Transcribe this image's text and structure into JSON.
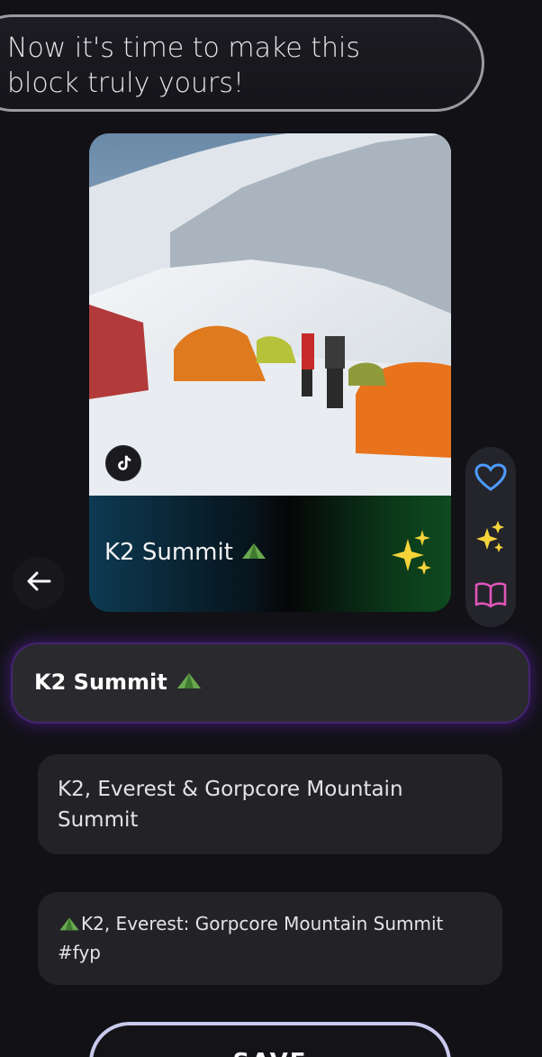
{
  "prompt": {
    "text": "Now it's time to make this block truly yours!"
  },
  "card": {
    "image_alt": "climbers and orange tents at a snowy mountain camp",
    "source_icon": "tiktok-icon",
    "title": "K2 Summit",
    "title_emoji": "tent-icon",
    "sparkle_icon": "sparkles-icon"
  },
  "rail": {
    "items": [
      {
        "icon": "heart-icon",
        "color": "#4d9bff"
      },
      {
        "icon": "sparkles-icon",
        "color": "#f5d43a"
      },
      {
        "icon": "book-icon",
        "color": "#e056b8"
      }
    ]
  },
  "back": {
    "icon": "arrow-left-icon"
  },
  "title_field": {
    "value": "K2 Summit"
  },
  "options": [
    {
      "text": "K2, Everest & Gorpcore Mountain Summit"
    },
    {
      "text": "K2, Everest: Gorpcore Mountain Summit #fyp"
    }
  ],
  "save": {
    "label": "SAVE"
  }
}
